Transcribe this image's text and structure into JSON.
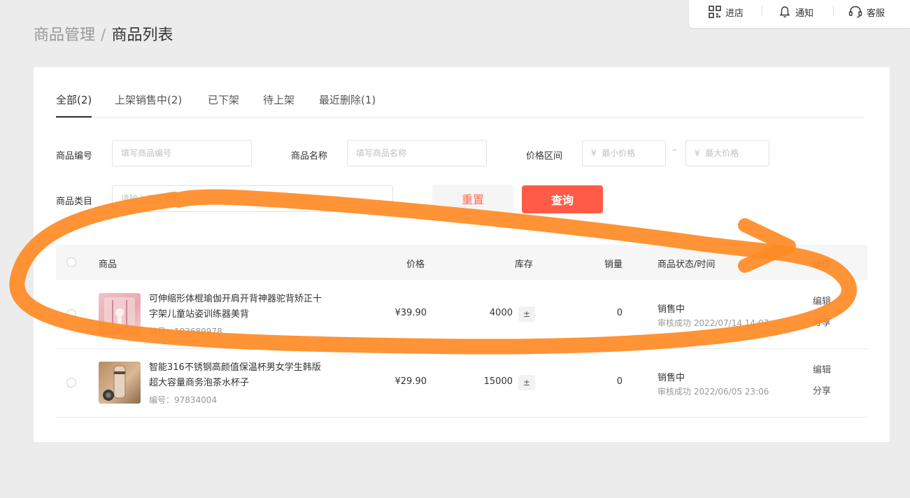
{
  "topbar": {
    "enter_store": "进店",
    "notifications": "通知",
    "customer_service": "客服"
  },
  "breadcrumb": {
    "parent": "商品管理",
    "separator": "/",
    "current": "商品列表"
  },
  "tabs": [
    {
      "label": "全部(2)",
      "active": true
    },
    {
      "label": "上架销售中(2)",
      "active": false
    },
    {
      "label": "已下架",
      "active": false
    },
    {
      "label": "待上架",
      "active": false
    },
    {
      "label": "最近删除(1)",
      "active": false
    }
  ],
  "filters": {
    "product_no": {
      "label": "商品编号",
      "placeholder": "填写商品编号"
    },
    "product_name": {
      "label": "商品名称",
      "placeholder": "填写商品名称"
    },
    "price_range": {
      "label": "价格区间",
      "min_placeholder": "¥  最小价格",
      "max_placeholder": "¥  最大价格",
      "separator": "–"
    },
    "category": {
      "label": "商品类目",
      "placeholder": "请输入类目搜索"
    },
    "reset_label": "重置",
    "query_label": "查询"
  },
  "table": {
    "headers": {
      "product": "商品",
      "price": "价格",
      "stock": "库存",
      "sales": "销量",
      "status_time": "商品状态/时间",
      "actions": "操作"
    },
    "rows": [
      {
        "name": "可伸缩形体棍瑜伽开肩开背神器驼背矫正十字架儿童站姿训练器美背",
        "id": "编号：103689978",
        "price": "¥39.90",
        "stock": "4000",
        "stock_icon": "±",
        "sales": "0",
        "status": "销售中",
        "status_detail": "审核成功  2022/07/14 14:07",
        "edit": "编辑",
        "share": "分享"
      },
      {
        "name": "智能316不锈钢高颜值保温杯男女学生韩版超大容量商务泡茶水杯子",
        "id": "编号：97834004",
        "price": "¥29.90",
        "stock": "15000",
        "stock_icon": "±",
        "sales": "0",
        "status": "销售中",
        "status_detail": "审核成功  2022/06/05 23:06",
        "edit": "编辑",
        "share": "分享"
      }
    ]
  },
  "colors": {
    "accent": "#ff5b46",
    "annotation": "#ff8a24"
  }
}
